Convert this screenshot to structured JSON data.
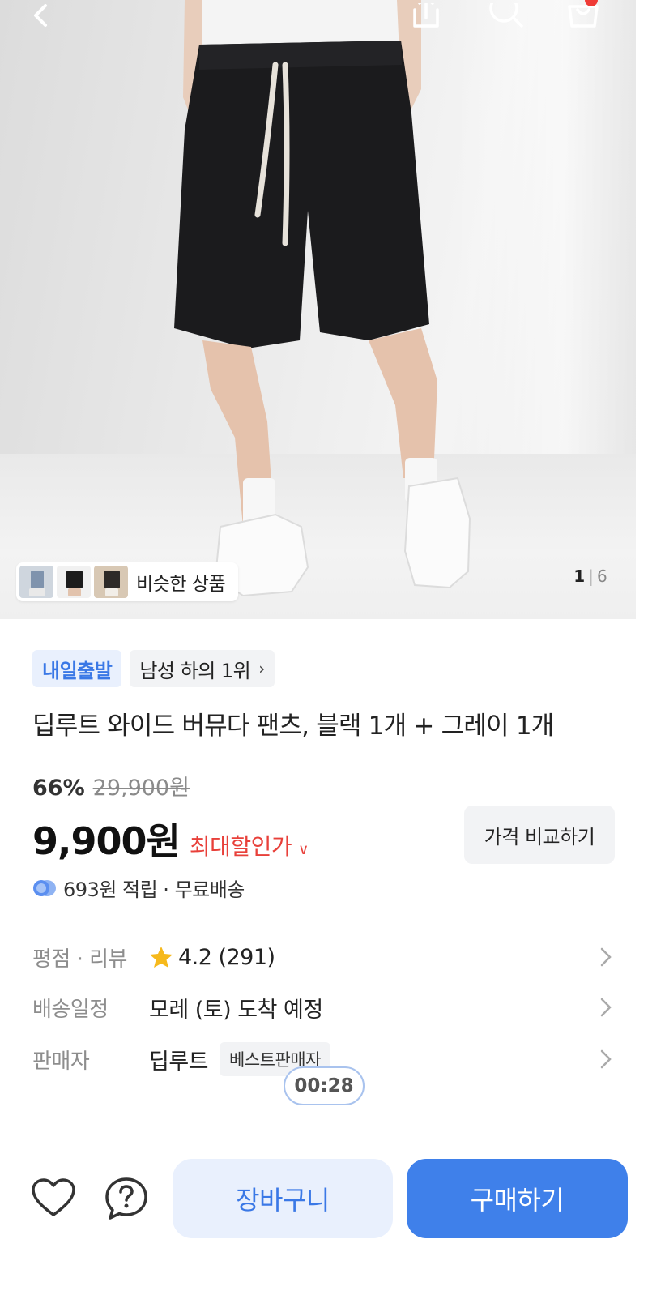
{
  "hero": {
    "similar_label": "비슷한 상품",
    "image_index": "1",
    "image_separator": "|",
    "image_total": "6"
  },
  "product": {
    "badge_delivery": "내일출발",
    "badge_rank": "남성 하의 1위",
    "title": "딥루트 와이드 버뮤다 팬츠, 블랙 1개 + 그레이 1개",
    "discount_rate": "66%",
    "original_price": "29,900원",
    "price": "9,900원",
    "max_discount_label": "최대할인가",
    "compare_button": "가격 비교하기",
    "reward_text": "693원 적립 · 무료배송"
  },
  "info": {
    "rating_label": "평점 · 리뷰",
    "rating_value": "4.2",
    "review_count": "(291)",
    "delivery_label": "배송일정",
    "delivery_value": "모레 (토) 도착 예정",
    "seller_label": "판매자",
    "seller_value": "딥루트",
    "seller_badge": "베스트판매자"
  },
  "timer": "00:28",
  "bottom_bar": {
    "cart_label": "장바구니",
    "buy_label": "구매하기"
  },
  "colors": {
    "accent_blue": "#3f80ea",
    "light_blue": "#e9f0fd",
    "sale_red": "#e8403a",
    "star_yellow": "#f6b91c"
  },
  "icons": [
    "back-arrow-icon",
    "share-icon",
    "search-icon",
    "cart-icon",
    "chevron-right-icon",
    "chevron-down-icon",
    "star-icon",
    "reward-coin-icon",
    "heart-icon",
    "question-icon"
  ]
}
